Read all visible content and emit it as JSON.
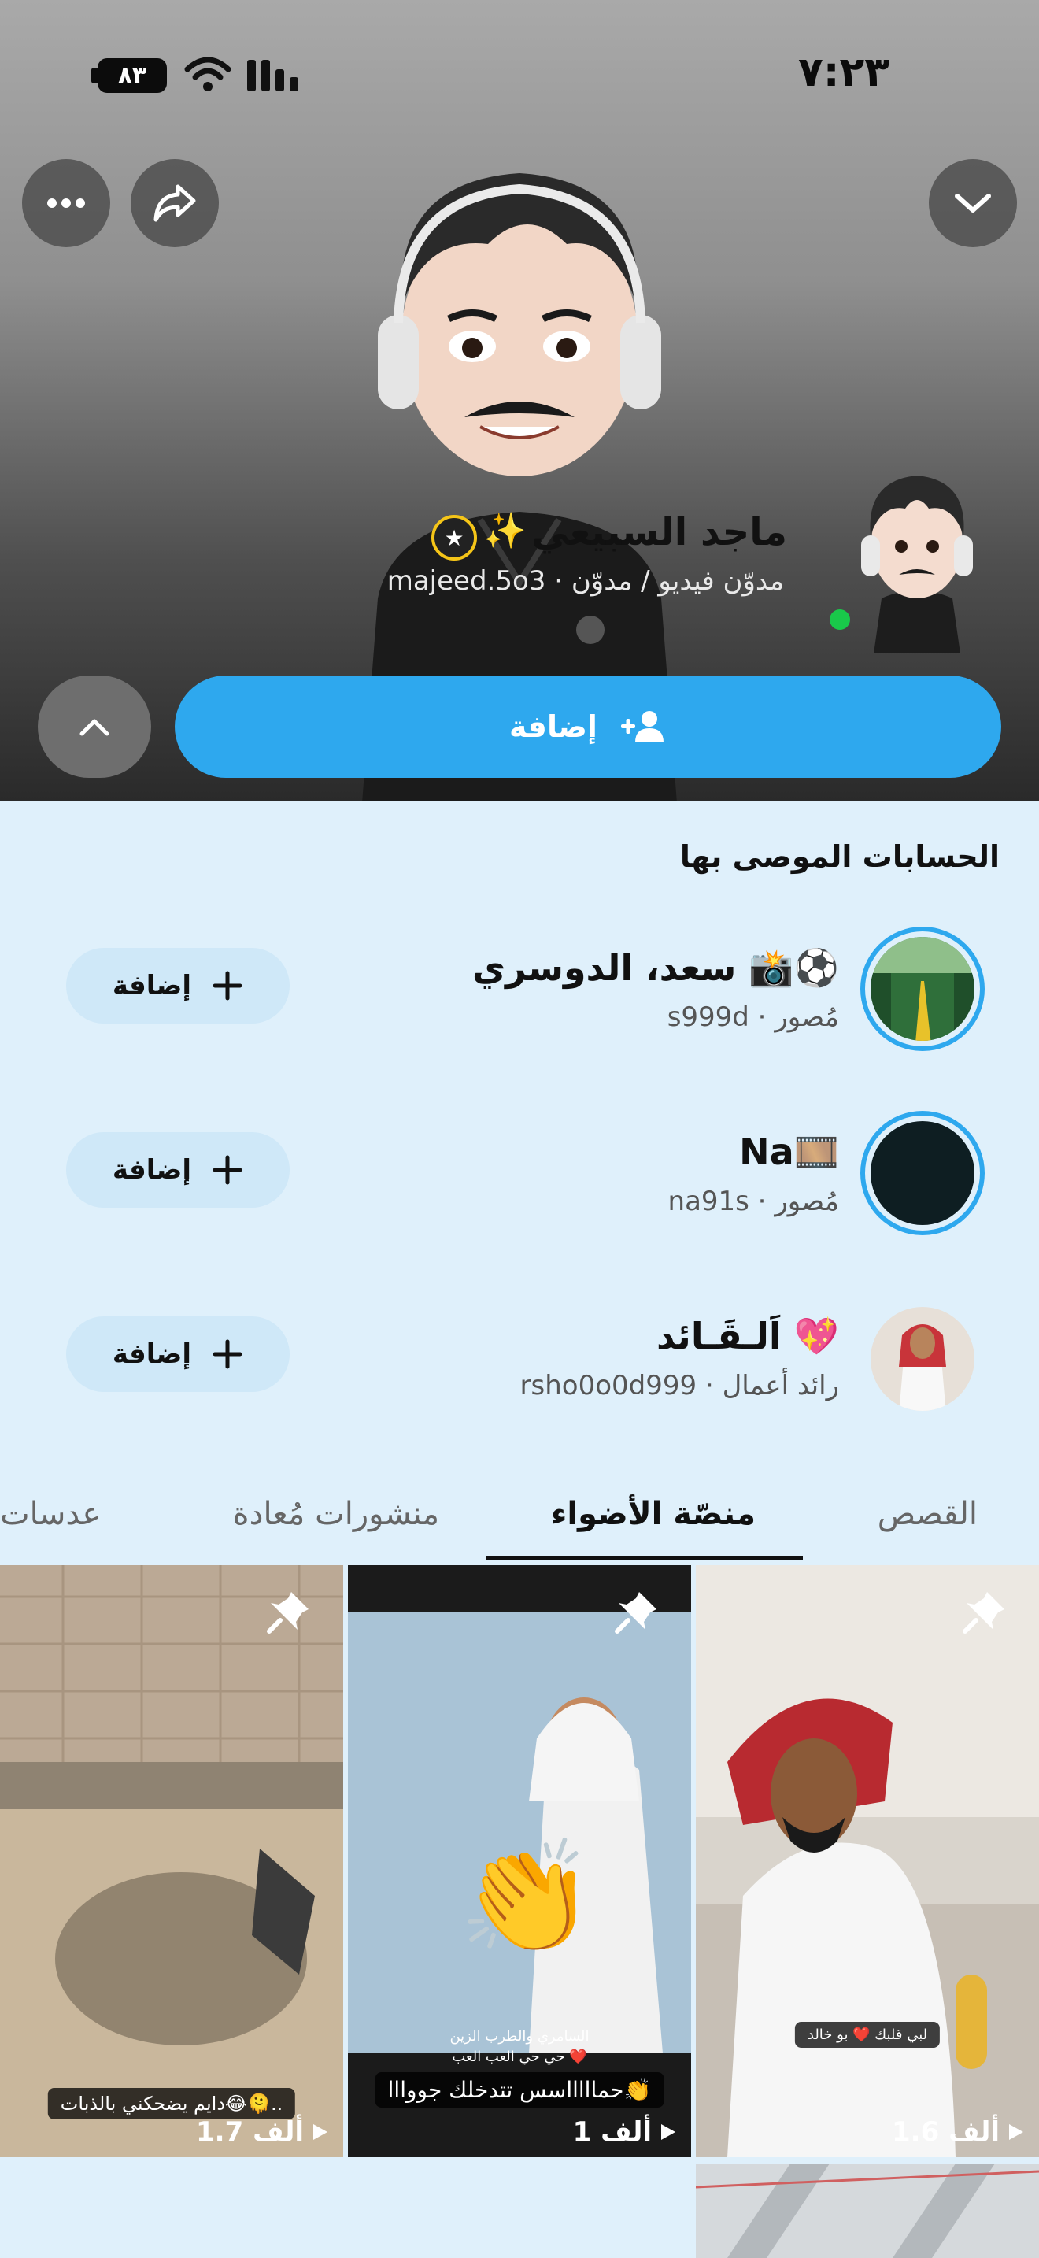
{
  "status_bar": {
    "time": "٧:٢٣",
    "battery": "٨٣"
  },
  "profile": {
    "name": "ماجد السبيعي",
    "sparkle": "✨",
    "subtitle": "majeed.5o3 · مدوّن فيديو / مدوّن",
    "add_label": "إضافة"
  },
  "recommended": {
    "title": "الحسابات الموصى بها",
    "items": [
      {
        "name": "سعد، الدوسري 📸⚽",
        "sub": "s999d · مُصور",
        "button": "إضافة"
      },
      {
        "name": "Na🎞️",
        "sub": "na91s · مُصور",
        "button": "إضافة"
      },
      {
        "name": "اَلـقَـائد 💖",
        "sub": "rsho0o0d999 · رائد أعمال",
        "button": "إضافة"
      }
    ]
  },
  "tabs": [
    "القصص",
    "منصّة الأضواء",
    "منشورات مُعادة",
    "عدسات"
  ],
  "active_tab_index": 1,
  "tiles": [
    {
      "caption": "لبي قلبك ❤️ بو خالد",
      "views": "1.6 ألف"
    },
    {
      "caption_top": "السامري والطرب الزين",
      "caption_mid": "حي حي العب العب ❤️",
      "caption": "حماااااسس تتدخلك جووااا👏",
      "views": "1 ألف"
    },
    {
      "caption": "دايم يضحكني بالذبات😂🫠..",
      "views": "1.7 ألف"
    }
  ],
  "colors": {
    "accent": "#2ea8ee",
    "background": "#dff0fb",
    "online": "#19c94a"
  }
}
